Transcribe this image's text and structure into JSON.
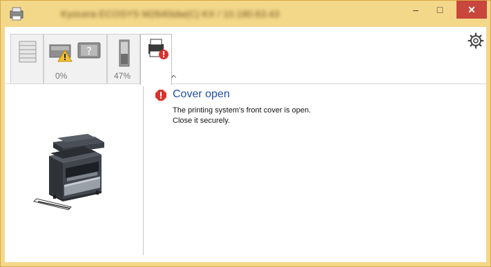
{
  "window": {
    "title": "Kyocera ECOSYS M2640idw(C) KX / 10.180.63.43",
    "minimize_glyph": "–",
    "maximize_glyph": "□",
    "close_glyph": "✕"
  },
  "toolbar": {
    "tabs": [
      {
        "name": "paper-status-tab",
        "label": ""
      },
      {
        "name": "toner-status-tab",
        "label": "0%"
      },
      {
        "name": "waste-toner-status-tab",
        "label": "47%"
      },
      {
        "name": "printer-status-tab",
        "label": ""
      }
    ],
    "collapse_glyph": "ᨈ"
  },
  "status": {
    "title": "Cover open",
    "line1": "The printing system's front cover is open.",
    "line2": "Close it securely."
  },
  "colors": {
    "accent": "#1f4fa6",
    "title_bar": "#f4d88a",
    "error": "#d9332b",
    "close_button": "#c9463d"
  },
  "icons": {
    "app": "printer-app-icon",
    "error": "error-icon",
    "settings": "gear-icon",
    "device": "printer-image"
  }
}
